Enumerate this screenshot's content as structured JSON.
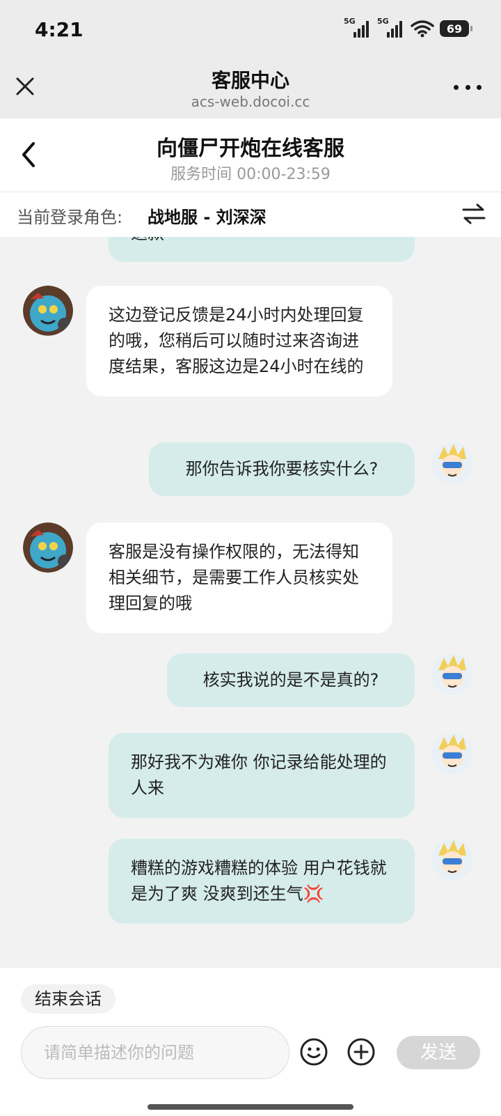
{
  "status_bar": {
    "time": "4:21",
    "signal1_label": "5G",
    "signal2_label": "5G",
    "battery": "69"
  },
  "app_header": {
    "title": "客服中心",
    "url": "acs-web.docoi.cc"
  },
  "chat_header": {
    "title": "向僵尸开炮在线客服",
    "subtitle": "服务时间 00:00-23:59"
  },
  "role_bar": {
    "label": "当前登录角色:",
    "value": "战地服 - 刘深深"
  },
  "messages": [
    {
      "from": "user",
      "text": "退款"
    },
    {
      "from": "agent",
      "text": "这边登记反馈是24小时内处理回复的哦，您稍后可以随时过来咨询进度结果，客服这边是24小时在线的"
    },
    {
      "from": "user",
      "text": "那你告诉我你要核实什么?"
    },
    {
      "from": "agent",
      "text": "客服是没有操作权限的，无法得知相关细节，是需要工作人员核实处理回复的哦"
    },
    {
      "from": "user",
      "text": "核实我说的是不是真的?"
    },
    {
      "from": "user",
      "text": "那好我不为难你 你记录给能处理的人来"
    },
    {
      "from": "user",
      "text": "糟糕的游戏糟糕的体验 用户花钱就是为了爽 没爽到还生气💢"
    }
  ],
  "bottom": {
    "end_label": "结束会话",
    "input_placeholder": "请简单描述你的问题",
    "input_value": "",
    "send_label": "发送"
  },
  "icons": {
    "close": "close-icon",
    "more": "more-icon",
    "back": "back-arrow-icon",
    "switch": "switch-arrows-icon",
    "emoji": "emoji-icon",
    "plus": "plus-icon"
  },
  "colors": {
    "user_bubble": "#d5ecea",
    "agent_bubble": "#ffffff",
    "send_disabled": "#d6d6d6"
  }
}
